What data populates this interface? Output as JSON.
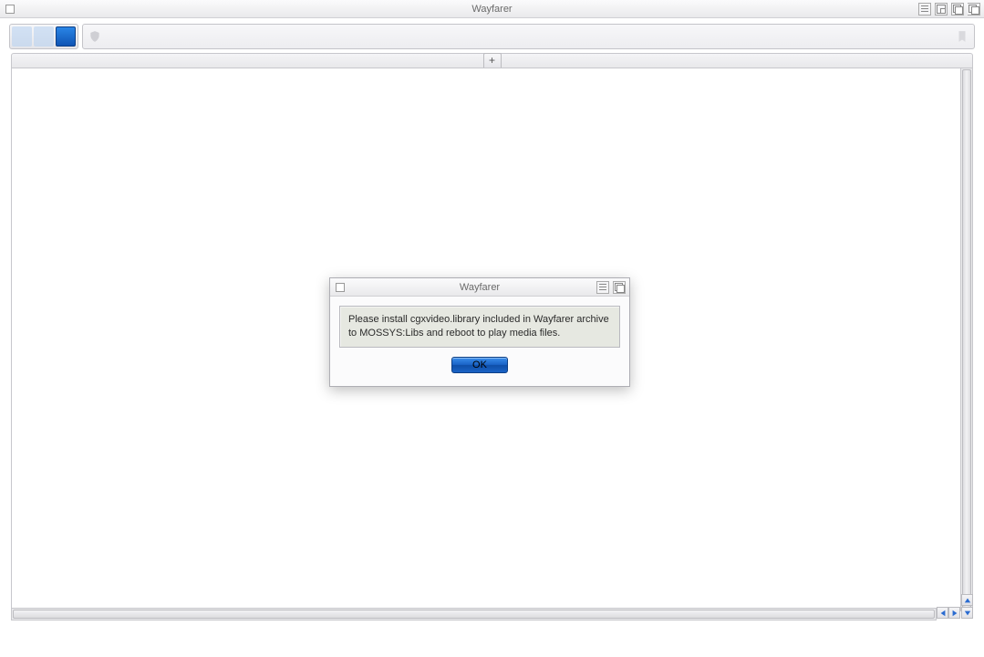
{
  "main_window": {
    "title": "Wayfarer"
  },
  "toolbar": {
    "address_value": "",
    "address_placeholder": ""
  },
  "tabstrip": {
    "newtab_label": "+"
  },
  "dialog": {
    "title": "Wayfarer",
    "message": "Please install cgxvideo.library included in Wayfarer archive to MOSSYS:Libs and reboot to play media files.",
    "ok_label": "OK"
  }
}
